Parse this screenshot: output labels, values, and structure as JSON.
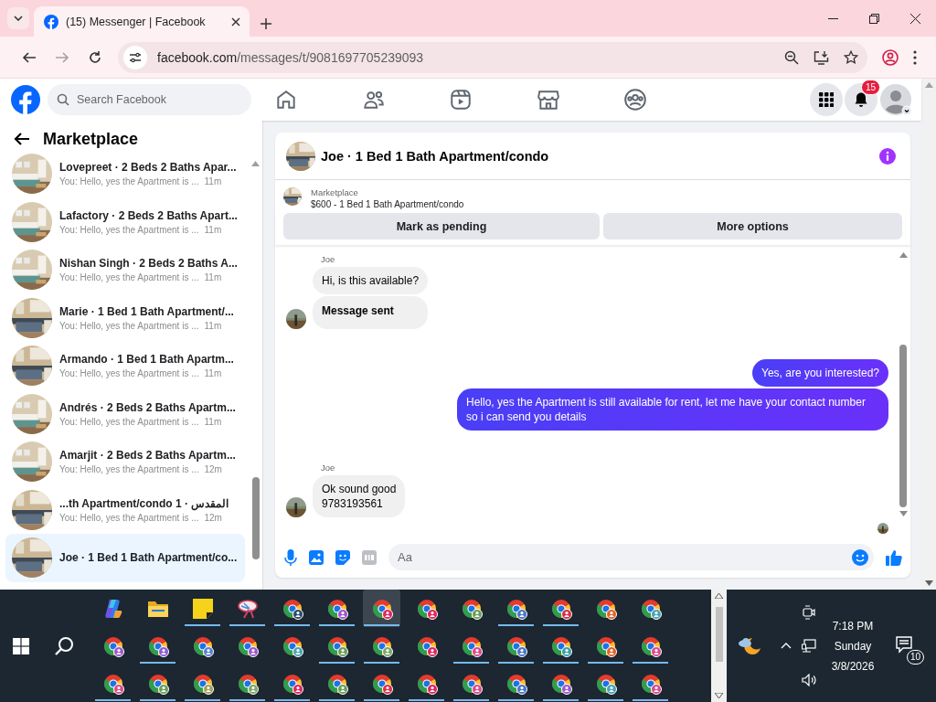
{
  "browser": {
    "tab_title": "(15) Messenger | Facebook",
    "url_host": "facebook.com",
    "url_path": "/messages/t/9081697705239093",
    "back_disabled": false,
    "forward_disabled": true
  },
  "facebook": {
    "search_placeholder": "Search Facebook",
    "notification_count": "15"
  },
  "sidebar": {
    "title": "Marketplace",
    "conversations": [
      {
        "name": "Lovepreet · 2 Beds 2 Baths Apar...",
        "preview": "You: Hello, yes the Apartment is ...",
        "time": "11m",
        "selected": false
      },
      {
        "name": "Lafactory · 2 Beds 2 Baths Apart...",
        "preview": "You: Hello, yes the Apartment is ...",
        "time": "11m",
        "selected": false
      },
      {
        "name": "Nishan Singh · 2 Beds 2 Baths A...",
        "preview": "You: Hello, yes the Apartment is ...",
        "time": "11m",
        "selected": false
      },
      {
        "name": "Marie · 1 Bed 1 Bath Apartment/...",
        "preview": "You: Hello, yes the Apartment is ...",
        "time": "11m",
        "selected": false
      },
      {
        "name": "Armando · 1 Bed 1 Bath Apartm...",
        "preview": "You: Hello, yes the Apartment is ...",
        "time": "11m",
        "selected": false
      },
      {
        "name": "Andrés · 2 Beds 2 Baths Apartm...",
        "preview": "You: Hello, yes the Apartment is ...",
        "time": "11m",
        "selected": false
      },
      {
        "name": "Amarjit · 2 Beds 2 Baths Apartm...",
        "preview": "You: Hello, yes the Apartment is ...",
        "time": "12m",
        "selected": false
      },
      {
        "name": "...th Apartment/condo 1 · المقدس",
        "preview": "You: Hello, yes the Apartment is ...",
        "time": "12m",
        "selected": false
      },
      {
        "name": "Joe · 1 Bed 1 Bath Apartment/co...",
        "selected": true
      }
    ]
  },
  "chat": {
    "title": "Joe · 1 Bed 1 Bath Apartment/condo",
    "listing": {
      "label": "Marketplace",
      "detail": "$600 - 1 Bed 1 Bath Apartment/condo"
    },
    "actions": [
      "Mark as pending",
      "More options"
    ],
    "groups": [
      {
        "kind": "incoming",
        "sender": "Joe",
        "bubbles": [
          {
            "kind": "text",
            "text": "Hi, is this available?"
          },
          {
            "kind": "notice",
            "text": "Message sent"
          }
        ]
      },
      {
        "kind": "outgoing",
        "bubbles": [
          {
            "kind": "text",
            "text": "Yes, are you interested?"
          },
          {
            "kind": "text",
            "text": "Hello, yes the Apartment is still available for rent, let me have your contact number so i can send you details"
          }
        ]
      },
      {
        "kind": "incoming",
        "sender": "Joe",
        "bubbles": [
          {
            "kind": "text",
            "text": "Ok sound good\n9783193561"
          }
        ]
      }
    ],
    "composer": {
      "placeholder": "Aa"
    }
  },
  "taskbar": {
    "rows": [
      [
        {
          "kind": "copilot",
          "running": false,
          "selected": false
        },
        {
          "kind": "folder",
          "running": false,
          "selected": false
        },
        {
          "kind": "notes",
          "running": true,
          "selected": false
        },
        {
          "kind": "snip",
          "running": true,
          "selected": false
        },
        {
          "kind": "chrome",
          "color": "#2c4a6a",
          "running": true,
          "selected": false
        },
        {
          "kind": "chrome",
          "color": "#9b59d0",
          "running": true,
          "selected": false
        },
        {
          "kind": "chrome",
          "color": "#e0245e",
          "running": true,
          "selected": true
        },
        {
          "kind": "chrome",
          "color": "#e0245e",
          "running": false,
          "selected": false
        },
        {
          "kind": "chrome",
          "color": "#6a9e5a",
          "running": false,
          "selected": false
        },
        {
          "kind": "chrome",
          "color": "#4a74c9",
          "running": true,
          "selected": false
        },
        {
          "kind": "chrome",
          "color": "#d9304a",
          "running": true,
          "selected": false
        },
        {
          "kind": "chrome",
          "color": "#e2632a",
          "running": false,
          "selected": false
        },
        {
          "kind": "chrome",
          "color": "#4aa3b5",
          "running": false,
          "selected": false
        }
      ],
      [
        {
          "kind": "chrome",
          "color": "#9b59d0",
          "running": false,
          "selected": false
        },
        {
          "kind": "chrome",
          "color": "#8f5ad8",
          "running": true,
          "selected": false
        },
        {
          "kind": "chrome",
          "color": "#5a7fd0",
          "running": false,
          "selected": false
        },
        {
          "kind": "chrome",
          "color": "#9b59d0",
          "running": false,
          "selected": false
        },
        {
          "kind": "chrome",
          "color": "#4aa3b5",
          "running": false,
          "selected": false
        },
        {
          "kind": "chrome",
          "color": "#6a9e5a",
          "running": true,
          "selected": false
        },
        {
          "kind": "chrome",
          "color": "#7aa86a",
          "running": true,
          "selected": false
        },
        {
          "kind": "chrome",
          "color": "#e0245e",
          "running": false,
          "selected": false
        },
        {
          "kind": "chrome",
          "color": "#d94a8c",
          "running": true,
          "selected": false
        },
        {
          "kind": "chrome",
          "color": "#4a74c9",
          "running": true,
          "selected": false
        },
        {
          "kind": "chrome",
          "color": "#3aa0a8",
          "running": true,
          "selected": false
        },
        {
          "kind": "chrome",
          "color": "#e2632a",
          "running": true,
          "selected": false
        },
        {
          "kind": "chrome",
          "color": "#d94a8c",
          "running": true,
          "selected": false
        }
      ],
      [
        {
          "kind": "chrome",
          "color": "#d94a8c",
          "running": true,
          "selected": false
        },
        {
          "kind": "chrome",
          "color": "#6a9e5a",
          "running": true,
          "selected": false
        },
        {
          "kind": "chrome",
          "color": "#9ea05a",
          "running": true,
          "selected": false
        },
        {
          "kind": "chrome",
          "color": "#7aa86a",
          "running": true,
          "selected": false
        },
        {
          "kind": "chrome",
          "color": "#e0245e",
          "running": true,
          "selected": false
        },
        {
          "kind": "chrome",
          "color": "#6a9e5a",
          "running": true,
          "selected": false
        },
        {
          "kind": "chrome",
          "color": "#d9304a",
          "running": true,
          "selected": false
        },
        {
          "kind": "chrome",
          "color": "#e0245e",
          "running": true,
          "selected": false
        },
        {
          "kind": "chrome",
          "color": "#d94a8c",
          "running": true,
          "selected": false
        },
        {
          "kind": "chrome",
          "color": "#4a74c9",
          "running": true,
          "selected": false
        },
        {
          "kind": "chrome",
          "color": "#9b59d0",
          "running": true,
          "selected": false
        },
        {
          "kind": "chrome",
          "color": "#4aa3b5",
          "running": true,
          "selected": false
        },
        {
          "kind": "chrome",
          "color": "#d94a8c",
          "running": true,
          "selected": false
        }
      ]
    ],
    "tray": {
      "time": "7:18 PM",
      "day": "Sunday",
      "date": "3/8/2026",
      "notification_count": "10"
    }
  }
}
